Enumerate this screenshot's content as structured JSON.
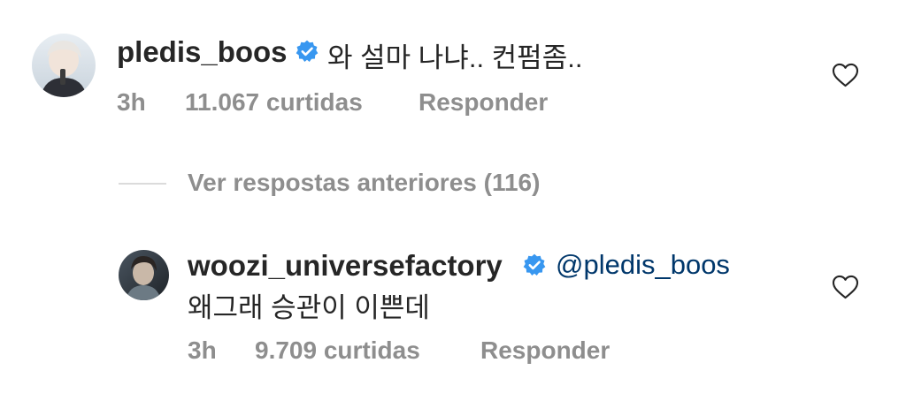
{
  "comments": [
    {
      "username": "pledis_boos",
      "text": "와 설마 나냐.. 컨펌좀..",
      "time": "3h",
      "likes": "11.067 curtidas",
      "reply_label": "Responder"
    },
    {
      "username": "woozi_universefactory",
      "mention": "@pledis_boos",
      "text": "왜그래 승관이 이쁜데",
      "time": "3h",
      "likes": "9.709 curtidas",
      "reply_label": "Responder"
    }
  ],
  "view_previous_replies": "Ver respostas anteriores (116)",
  "icons": {
    "verified": "verified-badge-icon",
    "like": "heart-outline-icon",
    "avatar_1": "avatar",
    "avatar_2": "avatar"
  },
  "colors": {
    "verified_blue": "#3897f0",
    "mention_blue": "#00376b",
    "secondary_text": "#8e8e8e",
    "primary_text": "#262626",
    "line": "#dbdbdb"
  }
}
